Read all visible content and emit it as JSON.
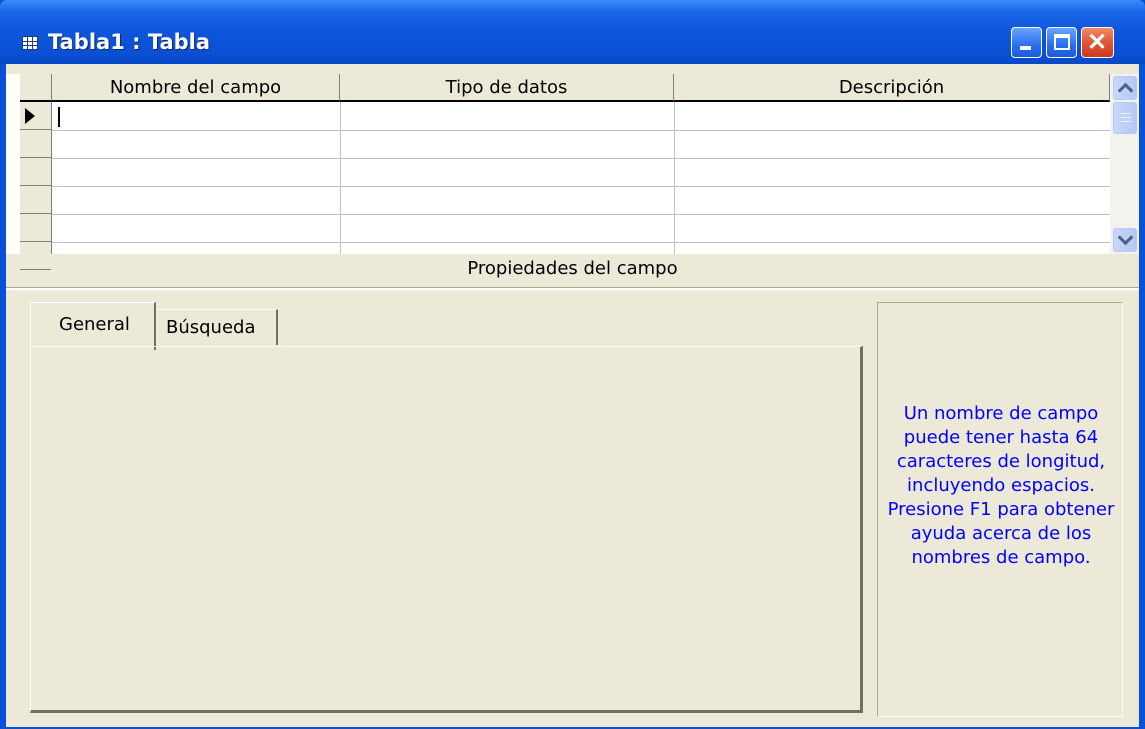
{
  "window": {
    "title": "Tabla1 : Tabla",
    "icon": "table-icon",
    "controls": [
      "minimize-icon",
      "maximize-icon",
      "close-icon"
    ]
  },
  "design_grid": {
    "columns": [
      "Nombre del campo",
      "Tipo de datos",
      "Descripción"
    ],
    "visible_rows": 5,
    "current_row_indicator": "row-selector-arrow-icon"
  },
  "field_properties": {
    "label": "Propiedades del campo",
    "tabs": [
      {
        "label": "General",
        "active": true
      },
      {
        "label": "Búsqueda",
        "active": false
      }
    ],
    "help_text": "Un nombre de campo puede tener hasta 64 caracteres de longitud, incluyendo espacios. Presione F1 para obtener ayuda acerca de los nombres de campo."
  },
  "colors": {
    "titlebar": "#0a4fd8",
    "face": "#ece9d8",
    "help_text": "#0000ff",
    "close_button": "#e05230"
  }
}
